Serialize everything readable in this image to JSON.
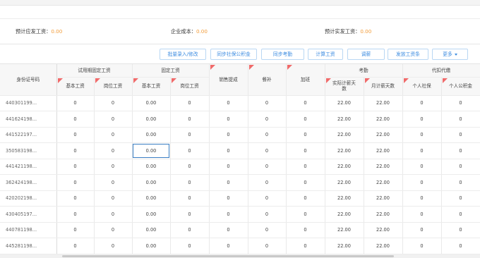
{
  "summary": {
    "expected_pay_label": "预计应发工资：",
    "expected_pay_value": "0.00",
    "company_cost_label": "企业成本：",
    "company_cost_value": "0.00",
    "net_pay_label": "预计实发工资：",
    "net_pay_value": "0.00"
  },
  "toolbar": {
    "batch_import": "批量录入/修改",
    "sync_social": "同步社保公积金",
    "sync_attendance": "同步考勤",
    "calc_pay": "计算工资",
    "adjust_pay": "调薪",
    "send_payslip": "发放工资条",
    "more": "更多"
  },
  "columns": {
    "id": "身份证号码",
    "probation_group": "试用期固定工资",
    "base_pay": "基本工资",
    "post_pay": "岗位工资",
    "fixed_group": "固定工资",
    "sales_commission": "销售提成",
    "meal_allowance": "餐补",
    "overtime": "加班",
    "attendance_group": "考勤",
    "actual_days": "实际计薪天数",
    "monthly_days": "月计薪天数",
    "withhold_group": "代扣代缴",
    "personal_social": "个人社保",
    "personal_fund": "个人公积金"
  },
  "rows": [
    [
      "440301199...",
      "0",
      "0",
      "0.00",
      "0",
      "0",
      "0",
      "0",
      "22.00",
      "22.00",
      "0",
      "0"
    ],
    [
      "441624198...",
      "0",
      "0",
      "0.00",
      "0",
      "0",
      "0",
      "0",
      "22.00",
      "22.00",
      "0",
      "0"
    ],
    [
      "441522197...",
      "0",
      "0",
      "0.00",
      "0",
      "0",
      "0",
      "0",
      "22.00",
      "22.00",
      "0",
      "0"
    ],
    [
      "350583198...",
      "0",
      "0",
      "0.00",
      "0",
      "0",
      "0",
      "0",
      "22.00",
      "22.00",
      "0",
      "0"
    ],
    [
      "441421198...",
      "0",
      "0",
      "0.00",
      "0",
      "0",
      "0",
      "0",
      "22.00",
      "22.00",
      "0",
      "0"
    ],
    [
      "362424198...",
      "0",
      "0",
      "0.00",
      "0",
      "0",
      "0",
      "0",
      "22.00",
      "22.00",
      "0",
      "0"
    ],
    [
      "420202198...",
      "0",
      "0",
      "0.00",
      "0",
      "0",
      "0",
      "0",
      "22.00",
      "22.00",
      "0",
      "0"
    ],
    [
      "430405197...",
      "0",
      "0",
      "0.00",
      "0",
      "0",
      "0",
      "0",
      "22.00",
      "22.00",
      "0",
      "0"
    ],
    [
      "440781198...",
      "0",
      "0",
      "0.00",
      "0",
      "0",
      "0",
      "0",
      "22.00",
      "22.00",
      "0",
      "0"
    ],
    [
      "445281198...",
      "0",
      "0",
      "0.00",
      "0",
      "0",
      "0",
      "0",
      "22.00",
      "22.00",
      "0",
      "0"
    ]
  ],
  "colors": {
    "accent": "#3b8be0",
    "value_orange": "#f29c3a",
    "flag_red": "#f06a6a"
  },
  "icons": {
    "more_caret": "chevron-down-icon",
    "cell_flag": "red-corner-flag-icon"
  }
}
